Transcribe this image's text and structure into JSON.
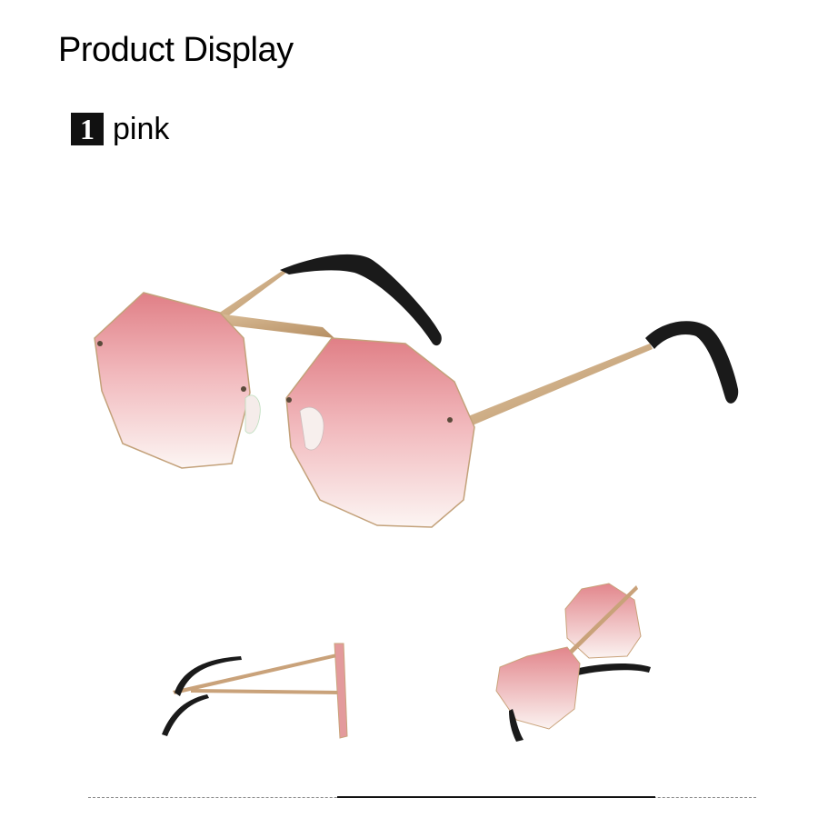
{
  "header": {
    "title": "Product Display"
  },
  "variant": {
    "number": "1",
    "color_name": "pink"
  },
  "colors": {
    "lens_top": "#e58a8e",
    "lens_bottom": "#fbf4f2",
    "frame": "#c9a27a",
    "temple_tip": "#1a1a1a"
  }
}
